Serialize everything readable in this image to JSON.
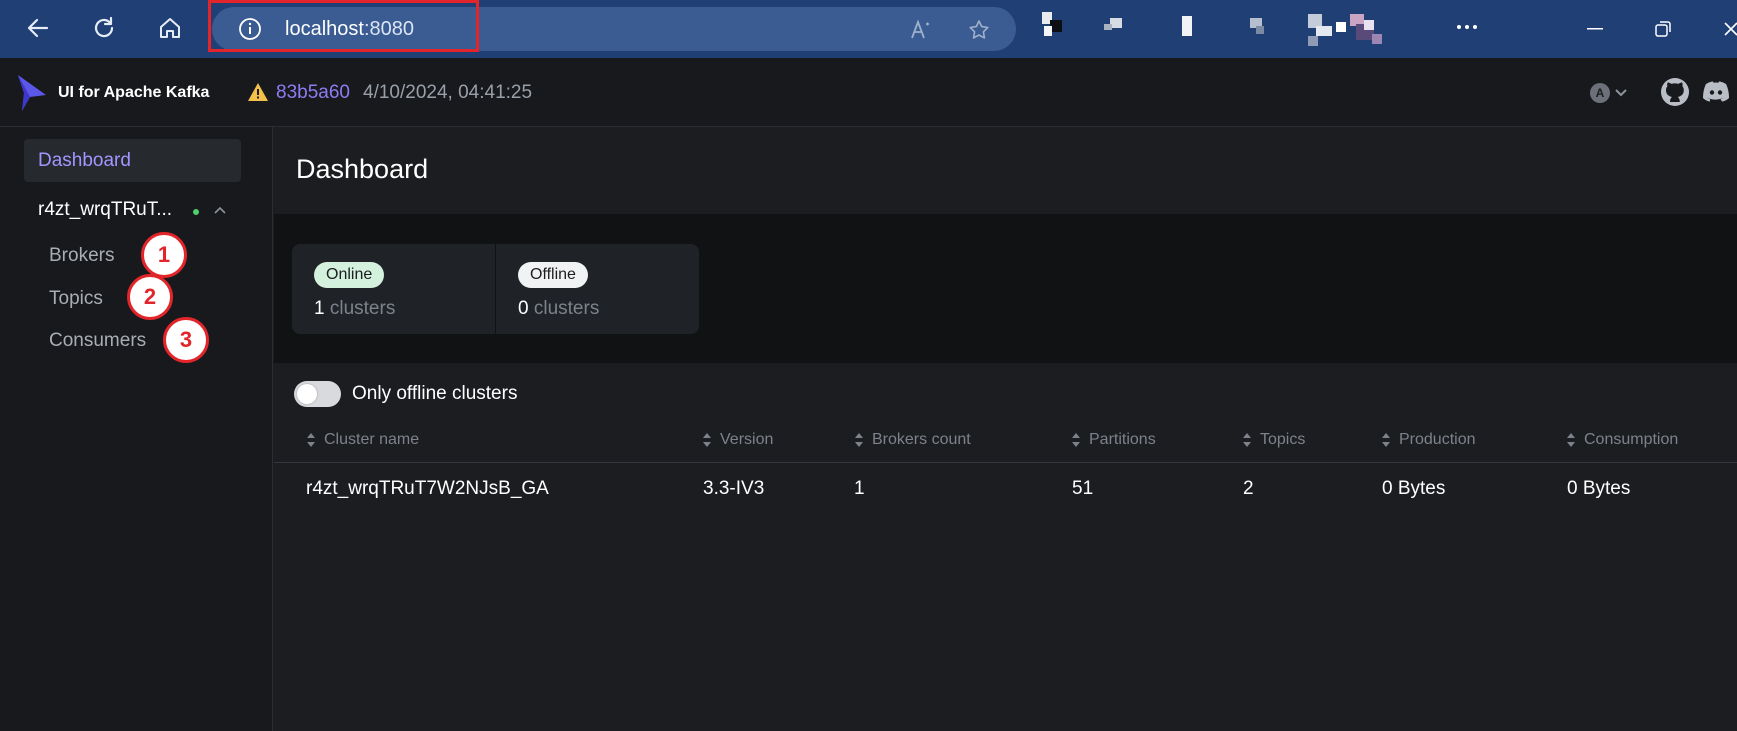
{
  "browser": {
    "url_host": "localhost",
    "url_port": ":8080"
  },
  "header": {
    "app_title": "UI for Apache Kafka",
    "version_hash": "83b5a60",
    "version_date": "4/10/2024, 04:41:25",
    "user_initial": "A"
  },
  "sidebar": {
    "dashboard_label": "Dashboard",
    "cluster_name": "r4zt_wrqTRuT...",
    "items": [
      {
        "label": "Brokers",
        "badge": "1"
      },
      {
        "label": "Topics",
        "badge": "2"
      },
      {
        "label": "Consumers",
        "badge": "3"
      }
    ]
  },
  "main": {
    "title": "Dashboard",
    "stats": [
      {
        "pill": "Online",
        "count": "1",
        "unit": "clusters"
      },
      {
        "pill": "Offline",
        "count": "0",
        "unit": "clusters"
      }
    ],
    "toggle_label": "Only offline clusters",
    "columns": [
      "Cluster name",
      "Version",
      "Brokers count",
      "Partitions",
      "Topics",
      "Production",
      "Consumption"
    ],
    "rows": [
      [
        "r4zt_wrqTRuT7W2NJsB_GA",
        "3.3-IV3",
        "1",
        "51",
        "2",
        "0 Bytes",
        "0 Bytes"
      ]
    ]
  },
  "colors": {
    "browser_bar": "#1f3f75",
    "accent": "#8f7cf3",
    "annotation_red": "#e2252a",
    "online_green": "#4fcf6e"
  }
}
